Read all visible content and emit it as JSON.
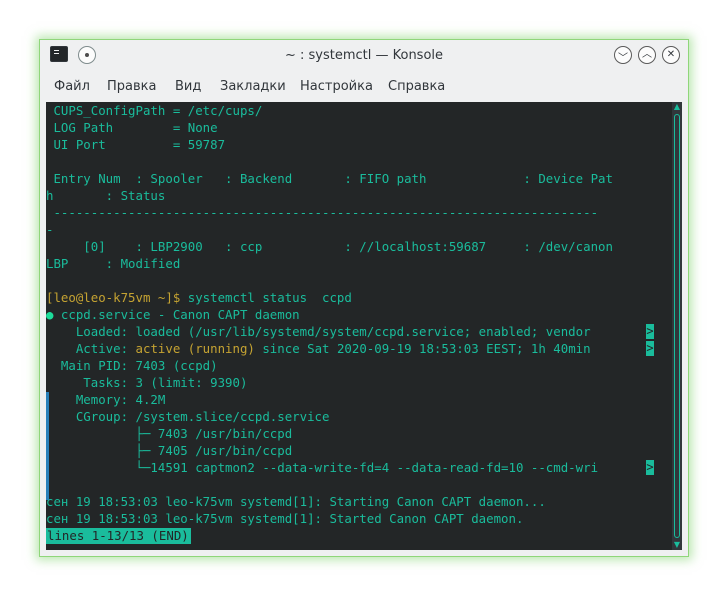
{
  "window": {
    "title": "~ : systemctl — Konsole",
    "controls": {
      "minimize": "︿",
      "maximize": "︿",
      "close": "✕"
    }
  },
  "menu": [
    "Файл",
    "Правка",
    "Вид",
    "Закладки",
    "Настройка",
    "Справка"
  ],
  "terminal": {
    "lines": [
      " CUPS_ConfigPath = /etc/cups/",
      " LOG Path        = None",
      " UI Port         = 59787",
      "",
      " Entry Num  : Spooler   : Backend       : FIFO path             : Device Pat",
      "h       : Status",
      " -------------------------------------------------------------------------",
      "-",
      "     [0]    : LBP2900   : ccp           : //localhost:59687     : /dev/canon",
      "LBP     : Modified"
    ],
    "prompt": {
      "user_host": "[leo@leo-k75vm ~]$",
      "command": " systemctl status  ccpd"
    },
    "service": {
      "bullet": "●",
      "header": " ccpd.service - Canon CAPT daemon",
      "loaded": "    Loaded: loaded (/usr/lib/systemd/system/ccpd.service; enabled; vendor ",
      "active_label": "    Active: ",
      "active_state": "active (running)",
      "active_rest": " since Sat 2020-09-19 18:53:03 EEST; 1h 40min ",
      "main_pid": "  Main PID: 7403 (ccpd)",
      "tasks": "     Tasks: 3 (limit: 9390)",
      "memory": "    Memory: 4.2M",
      "cgroup": "    CGroup: /system.slice/ccpd.service",
      "procs": [
        "            ├─ 7403 /usr/bin/ccpd",
        "            ├─ 7405 /usr/bin/ccpd",
        "            └─14591 captmon2 --data-write-fd=4 --data-read-fd=10 --cmd-wri"
      ],
      "truncation_marker": ">"
    },
    "journal": [
      "сен 19 18:53:03 leo-k75vm systemd[1]: Starting Canon CAPT daemon...",
      "сен 19 18:53:03 leo-k75vm systemd[1]: Started Canon CAPT daemon."
    ],
    "pager_status": "lines 1-13/13 (END)"
  },
  "scrollbar": {
    "up": "▲",
    "down": "▼"
  },
  "colors": {
    "terminal_bg": "#232627",
    "text": "#1abc9c",
    "active_state": "#c5a332",
    "accent_bar": "#2980b9"
  }
}
